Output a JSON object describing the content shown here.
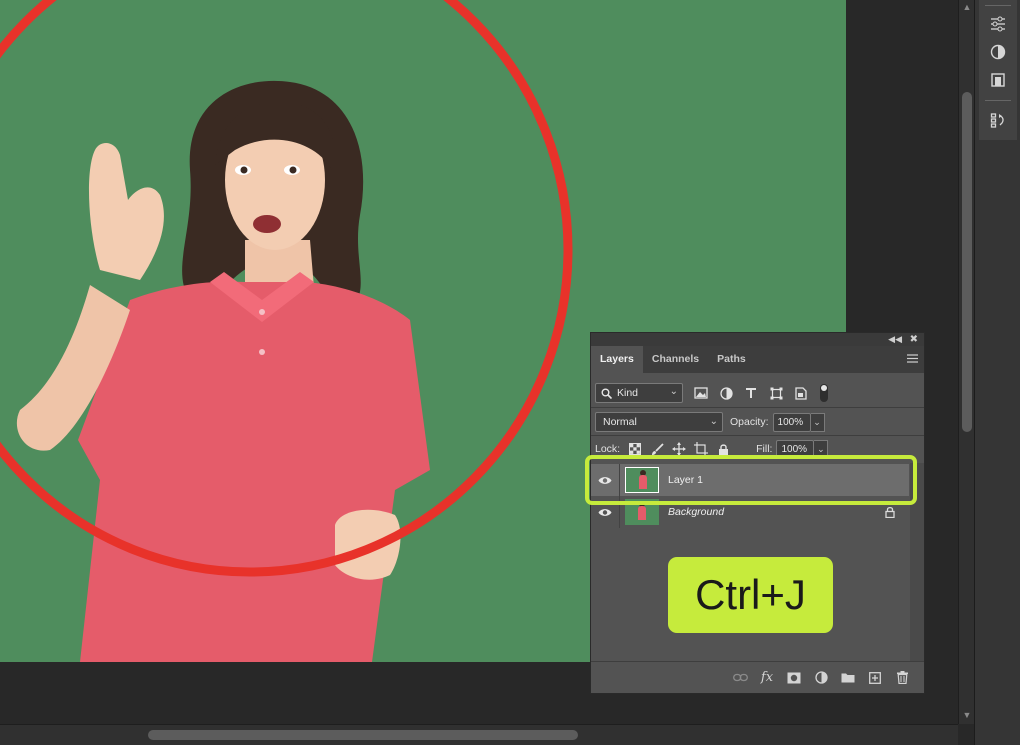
{
  "panel": {
    "tabs": [
      {
        "label": "Layers",
        "active": true
      },
      {
        "label": "Channels",
        "active": false
      },
      {
        "label": "Paths",
        "active": false
      }
    ],
    "filter": {
      "kind_label": "Kind"
    },
    "blend_mode": "Normal",
    "opacity_label": "Opacity:",
    "opacity_value": "100%",
    "lock_label": "Lock:",
    "fill_label": "Fill:",
    "fill_value": "100%",
    "layers": [
      {
        "name": "Layer 1",
        "selected": true,
        "visible": true
      },
      {
        "name": "Background",
        "selected": false,
        "visible": true,
        "locked": true
      }
    ]
  },
  "overlay": {
    "shortcut_text": "Ctrl+J",
    "highlight_color": "#c6eb3c"
  },
  "colors": {
    "canvas_green": "#4f8d5d",
    "shirt": "#e55c6a",
    "hoop": "#e8322a",
    "panel_bg": "#535353",
    "selected_row": "#6d6d6d"
  }
}
